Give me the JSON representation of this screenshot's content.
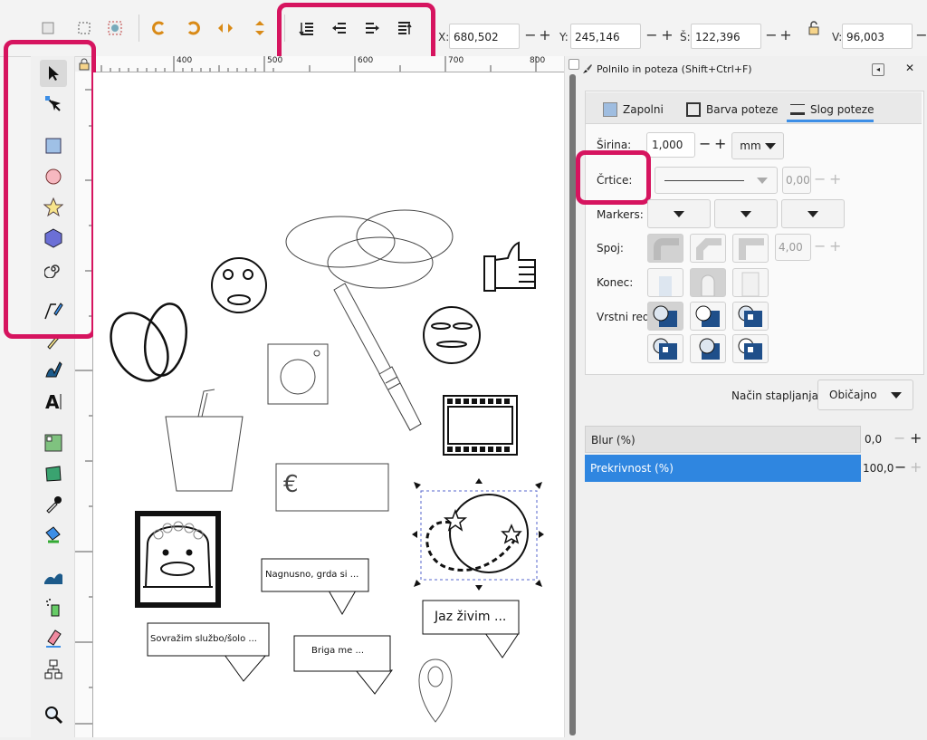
{
  "toolbar": {
    "x_label": "X:",
    "x_value": "680,502",
    "y_label": "Y:",
    "y_value": "245,146",
    "w_label": "Š:",
    "w_value": "122,396",
    "h_label": "V:",
    "h_value": "96,003",
    "minus": "−",
    "plus": "+"
  },
  "ruler": {
    "marks": [
      "400",
      "500",
      "600",
      "700",
      "800"
    ]
  },
  "tools": [
    "selector-arrow-icon",
    "node-tool-icon",
    "rectangle-icon",
    "ellipse-icon",
    "star-icon",
    "box3d-icon",
    "spiral-icon",
    "pen-icon",
    "pencil-icon",
    "calligraphy-icon",
    "text-icon",
    "gradient-icon",
    "mesh-icon",
    "dropper-icon",
    "paint-bucket-icon",
    "tweak-icon",
    "spray-icon",
    "eraser-icon",
    "connector-icon",
    "zoom-icon"
  ],
  "dock": {
    "title": "Polnilo in poteza  (Shift+Ctrl+F)",
    "tabs": {
      "fill": "Zapolni",
      "stroke_paint": "Barva poteze",
      "stroke_style": "Slog poteze"
    },
    "width_label": "Širina:",
    "width_value": "1,000",
    "width_unit": "mm",
    "dashes_label": "Črtice:",
    "dash_offset": "0,00",
    "markers_label": "Markers:",
    "join_label": "Spoj:",
    "miter_value": "4,00",
    "cap_label": "Konec:",
    "order_label": "Vrstni red:",
    "blend_label": "Način stapljanja:",
    "blend_value": "Običajno",
    "blur_label": "Blur (%)",
    "blur_value": "0,0",
    "opacity_label": "Prekrivnost (%)",
    "opacity_value": "100,0"
  },
  "canvas": {
    "bubble1": "Nagnusno, grda si ...",
    "bubble2": "Sovražim službo/šolo ...",
    "bubble3": "Briga me ...",
    "bubble4": "Jaz živim ...",
    "euro": "€"
  },
  "colors": {
    "highlight": "#d6145f",
    "accent": "#3c8ee6",
    "selected_bar": "#2f86e0"
  }
}
